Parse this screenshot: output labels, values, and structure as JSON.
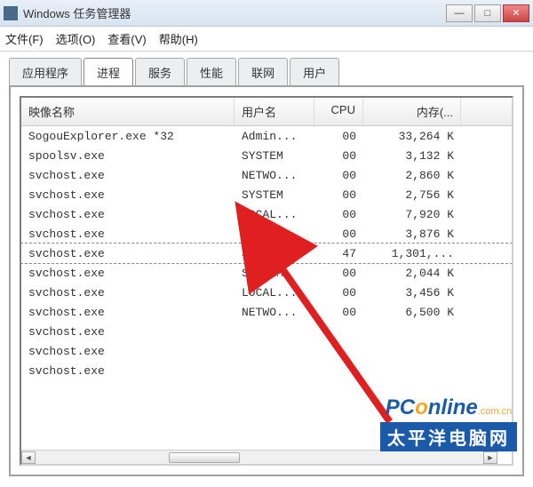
{
  "window": {
    "title": "Windows 任务管理器"
  },
  "menu": {
    "file": "文件(F)",
    "options": "选项(O)",
    "view": "查看(V)",
    "help": "帮助(H)"
  },
  "tabs": {
    "apps": "应用程序",
    "processes": "进程",
    "services": "服务",
    "performance": "性能",
    "networking": "联网",
    "users": "用户",
    "active": "processes"
  },
  "columns": {
    "image": "映像名称",
    "user": "用户名",
    "cpu": "CPU",
    "memory": "内存(..."
  },
  "processes": [
    {
      "name": "SogouExplorer.exe *32",
      "user": "Admin...",
      "cpu": "00",
      "mem": "33,264 K",
      "sel": false
    },
    {
      "name": "spoolsv.exe",
      "user": "SYSTEM",
      "cpu": "00",
      "mem": "3,132 K",
      "sel": false
    },
    {
      "name": "svchost.exe",
      "user": "NETWO...",
      "cpu": "00",
      "mem": "2,860 K",
      "sel": false
    },
    {
      "name": "svchost.exe",
      "user": "SYSTEM",
      "cpu": "00",
      "mem": "2,756 K",
      "sel": false
    },
    {
      "name": "svchost.exe",
      "user": "LOCAL...",
      "cpu": "00",
      "mem": "7,920 K",
      "sel": false
    },
    {
      "name": "svchost.exe",
      "user": "SYSTEM",
      "cpu": "00",
      "mem": "3,876 K",
      "sel": false
    },
    {
      "name": "svchost.exe",
      "user": "SYSTEM",
      "cpu": "47",
      "mem": "1,301,...",
      "sel": true
    },
    {
      "name": "svchost.exe",
      "user": "SYSTEM",
      "cpu": "00",
      "mem": "2,044 K",
      "sel": false
    },
    {
      "name": "svchost.exe",
      "user": "LOCAL...",
      "cpu": "00",
      "mem": "3,456 K",
      "sel": false
    },
    {
      "name": "svchost.exe",
      "user": "NETWO...",
      "cpu": "00",
      "mem": "6,500 K",
      "sel": false
    },
    {
      "name": "svchost.exe",
      "user": "",
      "cpu": "",
      "mem": "",
      "sel": false
    },
    {
      "name": "svchost.exe",
      "user": "",
      "cpu": "",
      "mem": "",
      "sel": false
    },
    {
      "name": "svchost.exe",
      "user": "",
      "cpu": "",
      "mem": "",
      "sel": false
    }
  ],
  "watermark": {
    "brand_main": "PConline",
    "brand_suffix": ".com.cn",
    "subtitle": "太平洋电脑网"
  },
  "win_buttons": {
    "min": "—",
    "max": "□",
    "close": "✕"
  },
  "scroll": {
    "left": "◄",
    "right": "►"
  }
}
